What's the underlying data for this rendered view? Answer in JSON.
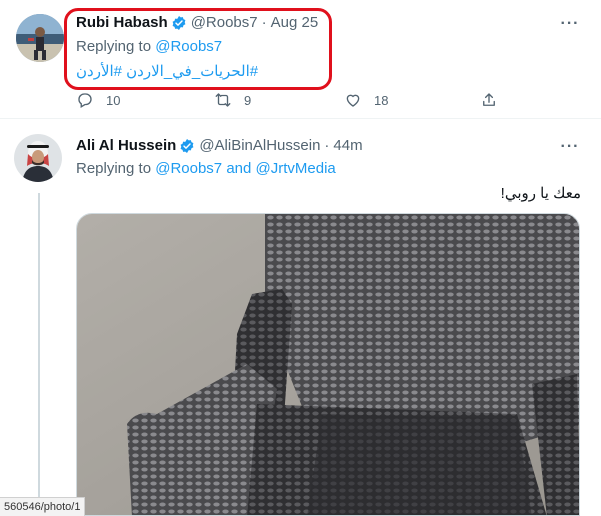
{
  "tweet1": {
    "display_name": "Rubi Habash",
    "handle": "@Roobs7",
    "separator": "·",
    "time": "Aug 25",
    "replying_prefix": "Replying to ",
    "replying_to": "@Roobs7",
    "hashtags": "#الحريات_في_الاردن #الأردن",
    "counts": {
      "reply": "10",
      "retweet": "9",
      "like": "18"
    }
  },
  "tweet2": {
    "display_name": "Ali Al Hussein",
    "handle": "@AliBinAlHussein",
    "separator": "·",
    "time": "44m",
    "replying_prefix": "Replying to ",
    "replying_to_1": "@Roobs7",
    "replying_and": " and ",
    "replying_to_2": "@JrtvMedia",
    "text": "معك يا روبي!"
  },
  "status_url": "560546/photo/1",
  "colors": {
    "accent": "#1d9bf0",
    "muted": "#536471",
    "highlight": "#e0101c",
    "border": "#eff3f4"
  },
  "icons": [
    "verified-badge-icon",
    "more-icon",
    "reply-icon",
    "retweet-icon",
    "like-icon",
    "share-icon"
  ]
}
